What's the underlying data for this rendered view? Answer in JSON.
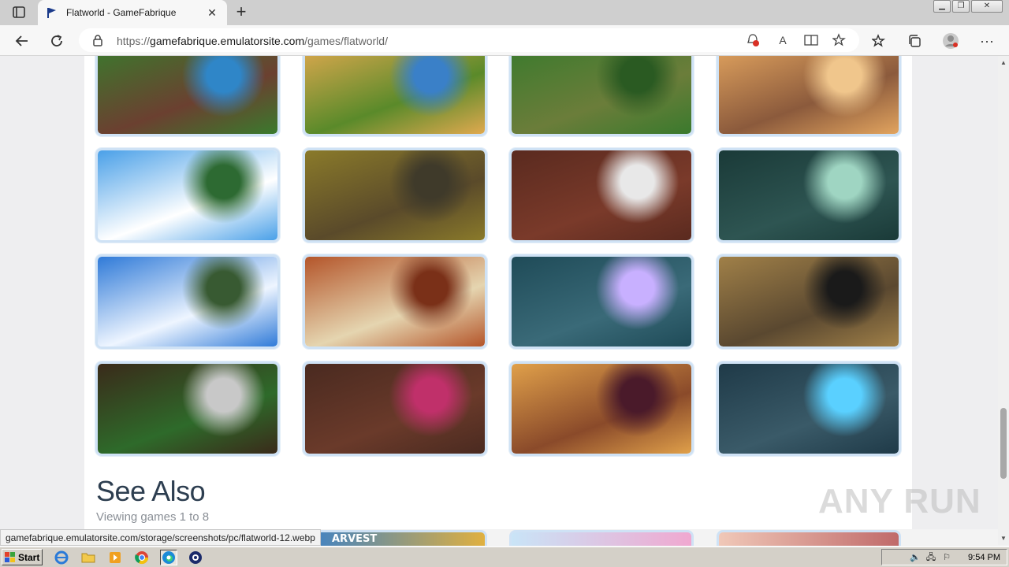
{
  "browser": {
    "tab_title": "Flatworld - GameFabrique",
    "tab_close": "✕",
    "new_tab": "+",
    "window_buttons": {
      "minimize": "▁",
      "restore": "❐",
      "close": "✕"
    },
    "url_prefix": "https://",
    "url_host": "gamefabrique.emulatorsite.com",
    "url_path": "/games/flatworld/",
    "status_url": "gamefabrique.emulatorsite.com/storage/screenshots/pc/flatworld-12.webp",
    "menu_dots": "···",
    "read_aloud_label": "A",
    "icons": [
      "back-arrow-icon",
      "refresh-icon",
      "lock-icon",
      "tracking-prevention-icon",
      "read-aloud-icon",
      "immersive-reader-icon",
      "add-favorite-icon",
      "favorites-icon",
      "collections-icon",
      "profile-icon",
      "settings-more-icon"
    ]
  },
  "page": {
    "screenshots": [
      {
        "name": "bridge",
        "colors": [
          "#3a7a2d",
          "#6b4030",
          "#2f86c8"
        ]
      },
      {
        "name": "desert-palm",
        "colors": [
          "#e0a94f",
          "#5a8a2a",
          "#3a80c8"
        ]
      },
      {
        "name": "village",
        "colors": [
          "#3a7a2d",
          "#6b7d3a",
          "#2a5a22"
        ]
      },
      {
        "name": "boat",
        "colors": [
          "#e2a45f",
          "#8b5a3c",
          "#f0c68c"
        ]
      },
      {
        "name": "helicopter",
        "colors": [
          "#4aa0e8",
          "#ffffff",
          "#2d6a32"
        ]
      },
      {
        "name": "wagons",
        "colors": [
          "#8a7a2a",
          "#5a4a2a",
          "#3f3a2a"
        ]
      },
      {
        "name": "doorway",
        "colors": [
          "#5a2a1f",
          "#7a3a2a",
          "#e8e8e8"
        ]
      },
      {
        "name": "dark-room",
        "colors": [
          "#1a3a38",
          "#2e5552",
          "#9fd5c2"
        ]
      },
      {
        "name": "flying-carpet",
        "colors": [
          "#2f7ad8",
          "#eef5ff",
          "#385a32"
        ]
      },
      {
        "name": "map-table",
        "colors": [
          "#b4552a",
          "#e5d5b0",
          "#7a3018"
        ]
      },
      {
        "name": "dungeon-ice",
        "colors": [
          "#1f4b58",
          "#3a6a78",
          "#c8b0ff"
        ]
      },
      {
        "name": "stone-floor",
        "colors": [
          "#a08048",
          "#5a4830",
          "#1a1a1a"
        ]
      },
      {
        "name": "treehouse",
        "colors": [
          "#3a2a1a",
          "#2e6a2a",
          "#c8c8c8"
        ]
      },
      {
        "name": "wood-room",
        "colors": [
          "#4a2a20",
          "#6a3a2a",
          "#c0306a"
        ]
      },
      {
        "name": "sand-room",
        "colors": [
          "#e0a04a",
          "#8a4a2a",
          "#4a1a2a"
        ]
      },
      {
        "name": "blue-dungeon",
        "colors": [
          "#1f3a48",
          "#3a5a68",
          "#5ad0ff"
        ]
      }
    ],
    "see_also_title": "See Also",
    "viewing_text": "Viewing games 1 to 8",
    "bottom_thumbs": [
      {
        "colors": [
          "#3a80c8",
          "#e0b040"
        ],
        "text": "ARVEST"
      },
      {
        "colors": [
          "#c9e4f7",
          "#f0a8d0"
        ],
        "text": ""
      },
      {
        "colors": [
          "#f0c8b8",
          "#c06a6a"
        ],
        "text": ""
      }
    ]
  },
  "watermark": "ANY RUN",
  "taskbar": {
    "start_label": "Start",
    "clock": "9:54 PM",
    "quick_launch": [
      "ie-icon",
      "folder-icon",
      "media-player-icon",
      "chrome-icon",
      "edge-icon",
      "app-icon"
    ]
  },
  "colors": {
    "accent_blue": "#cfe2f5",
    "heading": "#2d3e50",
    "muted": "#8a8f96"
  }
}
